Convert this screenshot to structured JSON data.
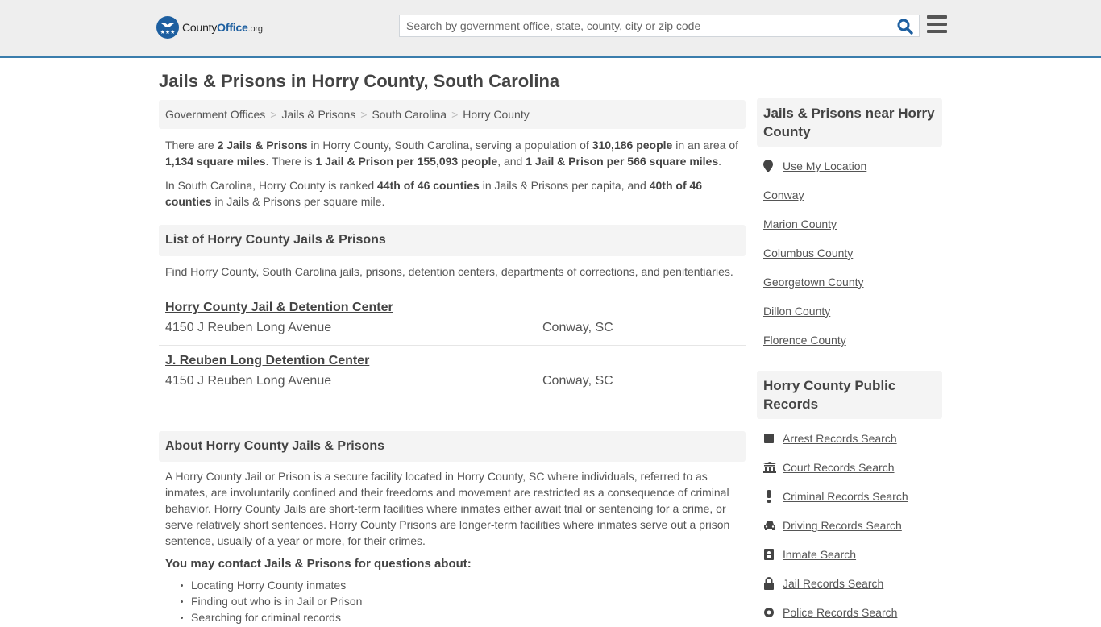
{
  "header": {
    "logo": {
      "brand_main": "County",
      "brand_accent": "Office",
      "brand_tld": ".org"
    },
    "search": {
      "placeholder": "Search by government office, state, county, city or zip code",
      "value": ""
    },
    "search_icon": "search-icon",
    "menu_icon": "hamburger-menu-icon"
  },
  "page": {
    "title": "Jails & Prisons in Horry County, South Carolina",
    "breadcrumb": [
      "Government Offices",
      "Jails & Prisons",
      "South Carolina",
      "Horry County"
    ]
  },
  "intro": {
    "p1": {
      "t1": "There are ",
      "b1": "2 Jails & Prisons",
      "t2": " in Horry County, South Carolina, serving a population of ",
      "b2": "310,186 people",
      "t3": " in an area of ",
      "b3": "1,134 square miles",
      "t4": ". There is ",
      "b4": "1 Jail & Prison per 155,093 people",
      "t5": ", and ",
      "b5": "1 Jail & Prison per 566 square miles",
      "t6": "."
    },
    "p2": {
      "t1": "In South Carolina, Horry County is ranked ",
      "b1": "44th of 46 counties",
      "t2": " in Jails & Prisons per capita, and ",
      "b2": "40th of 46 counties",
      "t3": " in Jails & Prisons per square mile."
    }
  },
  "list": {
    "heading": "List of Horry County Jails & Prisons",
    "description": "Find Horry County, South Carolina jails, prisons, detention centers, departments of corrections, and penitentiaries.",
    "facilities": [
      {
        "name": "Horry County Jail & Detention Center",
        "address": "4150 J Reuben Long Avenue",
        "city": "Conway, SC"
      },
      {
        "name": "J. Reuben Long Detention Center",
        "address": "4150 J Reuben Long Avenue",
        "city": "Conway, SC"
      }
    ]
  },
  "about": {
    "heading": "About Horry County Jails & Prisons",
    "text": "A Horry County Jail or Prison is a secure facility located in Horry County, SC where individuals, referred to as inmates, are involuntarily confined and their freedoms and movement are restricted as a consequence of criminal behavior. Horry County Jails are short-term facilities where inmates either await trial or sentencing for a crime, or serve relatively short sentences. Horry County Prisons are longer-term facilities where inmates serve out a prison sentence, usually of a year or more, for their crimes.",
    "contact_heading": "You may contact Jails & Prisons for questions about:",
    "contact_items": [
      "Locating Horry County inmates",
      "Finding out who is in Jail or Prison",
      "Searching for criminal records"
    ]
  },
  "sidebar": {
    "nearby": {
      "heading": "Jails & Prisons near Horry County",
      "use_location": {
        "label": "Use My Location",
        "icon": "map-marker-icon"
      },
      "items": [
        "Conway",
        "Marion County",
        "Columbus County",
        "Georgetown County",
        "Dillon County",
        "Florence County"
      ]
    },
    "records": {
      "heading": "Horry County Public Records",
      "items": [
        {
          "label": "Arrest Records Search",
          "icon": "arrest-square-icon"
        },
        {
          "label": "Court Records Search",
          "icon": "courthouse-icon"
        },
        {
          "label": "Criminal Records Search",
          "icon": "exclamation-icon"
        },
        {
          "label": "Driving Records Search",
          "icon": "car-icon"
        },
        {
          "label": "Inmate Search",
          "icon": "id-badge-icon"
        },
        {
          "label": "Jail Records Search",
          "icon": "lock-icon"
        },
        {
          "label": "Police Records Search",
          "icon": "police-badge-icon"
        }
      ]
    }
  },
  "colors": {
    "brand_blue": "#1d5fa0",
    "header_border": "#3a7dac",
    "header_bg": "#eeeeee",
    "panel_bg": "#f4f4f4",
    "text": "#555555"
  }
}
